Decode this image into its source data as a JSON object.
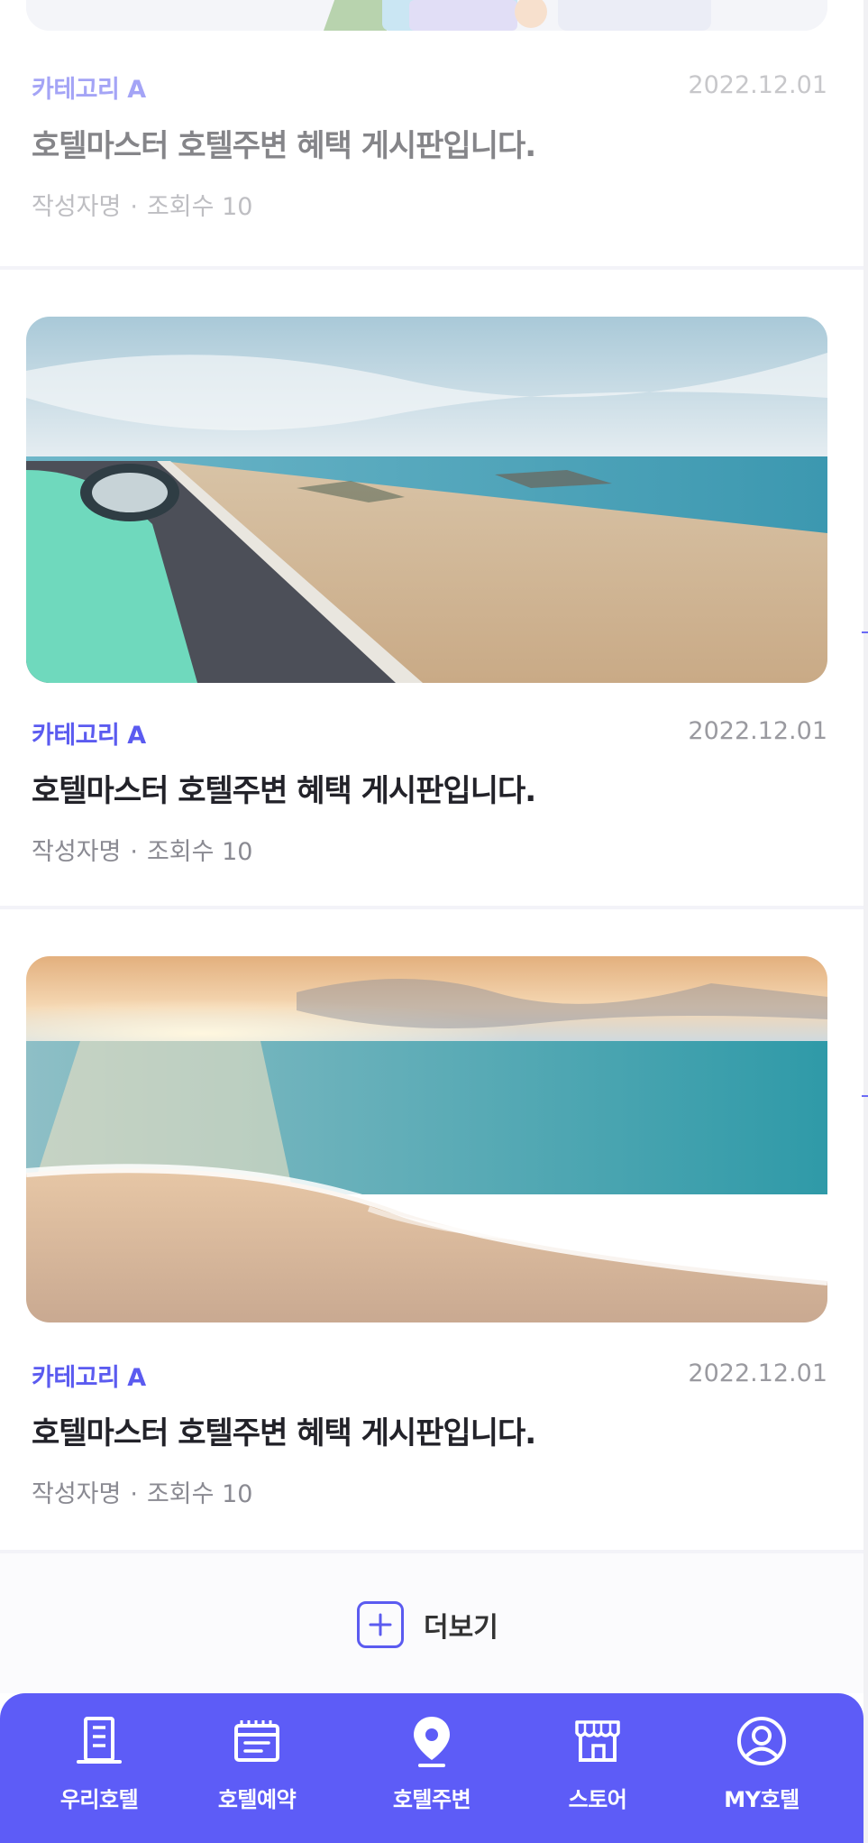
{
  "posts": [
    {
      "category": "카테고리 A",
      "date": "2022.12.01",
      "title": "호텔마스터 호텔주변 혜택 게시판입니다.",
      "author": "작성자명",
      "dot": "·",
      "views": "조회수 10",
      "image": "illustration-image"
    },
    {
      "category": "카테고리 A",
      "date": "2022.12.01",
      "title": "호텔마스터 호텔주변 혜택 게시판입니다.",
      "author": "작성자명",
      "dot": "·",
      "views": "조회수 10",
      "image": "coastal-road-image"
    },
    {
      "category": "카테고리 A",
      "date": "2022.12.01",
      "title": "호텔마스터 호텔주변 혜택 게시판입니다.",
      "author": "작성자명",
      "dot": "·",
      "views": "조회수 10",
      "image": "sunset-beach-image"
    }
  ],
  "more": {
    "label": "더보기",
    "icon": "plus-icon"
  },
  "tabbar": {
    "items": [
      {
        "label": "우리호텔",
        "icon": "building-icon"
      },
      {
        "label": "호텔예약",
        "icon": "calendar-icon"
      },
      {
        "label": "호텔주변",
        "icon": "location-pin-icon"
      },
      {
        "label": "스토어",
        "icon": "store-icon"
      },
      {
        "label": "MY호텔",
        "icon": "user-icon"
      }
    ]
  },
  "colors": {
    "accent": "#5d5cf7",
    "category": "#5b5bf0",
    "background": "#ffffff"
  }
}
